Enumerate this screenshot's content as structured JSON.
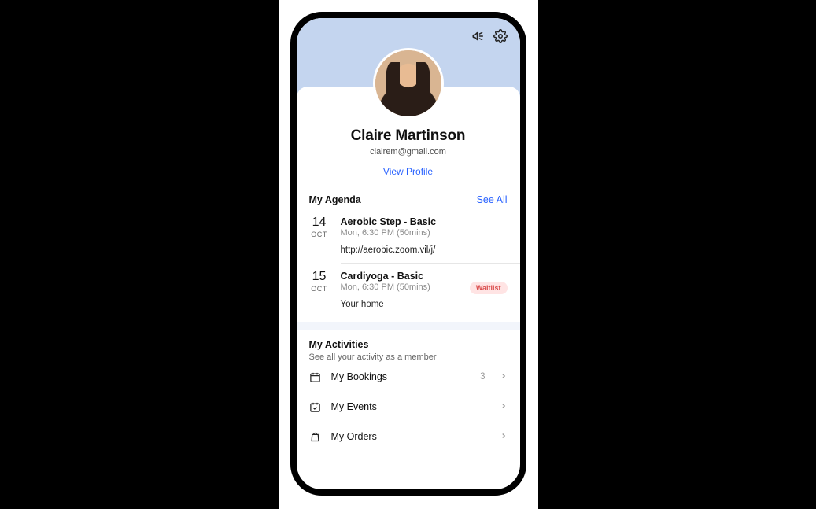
{
  "profile": {
    "name": "Claire Martinson",
    "email": "clairem@gmail.com",
    "view_profile_label": "View Profile"
  },
  "agenda": {
    "title": "My Agenda",
    "see_all_label": "See All",
    "items": [
      {
        "day": "14",
        "month": "OCT",
        "title": "Aerobic Step - Basic",
        "subtitle": "Mon, 6:30 PM (50mins)",
        "location": "http://aerobic.zoom.vil/j/",
        "badge": null
      },
      {
        "day": "15",
        "month": "OCT",
        "title": "Cardiyoga - Basic",
        "subtitle": "Mon, 6:30 PM (50mins)",
        "location": "Your home",
        "badge": "Waitlist"
      }
    ]
  },
  "activities": {
    "title": "My Activities",
    "subtitle": "See all your activity as a member",
    "items": [
      {
        "icon": "calendar-icon",
        "label": "My Bookings",
        "count": "3"
      },
      {
        "icon": "event-check-icon",
        "label": "My Events",
        "count": ""
      },
      {
        "icon": "bag-icon",
        "label": "My Orders",
        "count": ""
      }
    ]
  },
  "icons": {
    "megaphone": "megaphone-icon",
    "gear": "gear-icon"
  }
}
